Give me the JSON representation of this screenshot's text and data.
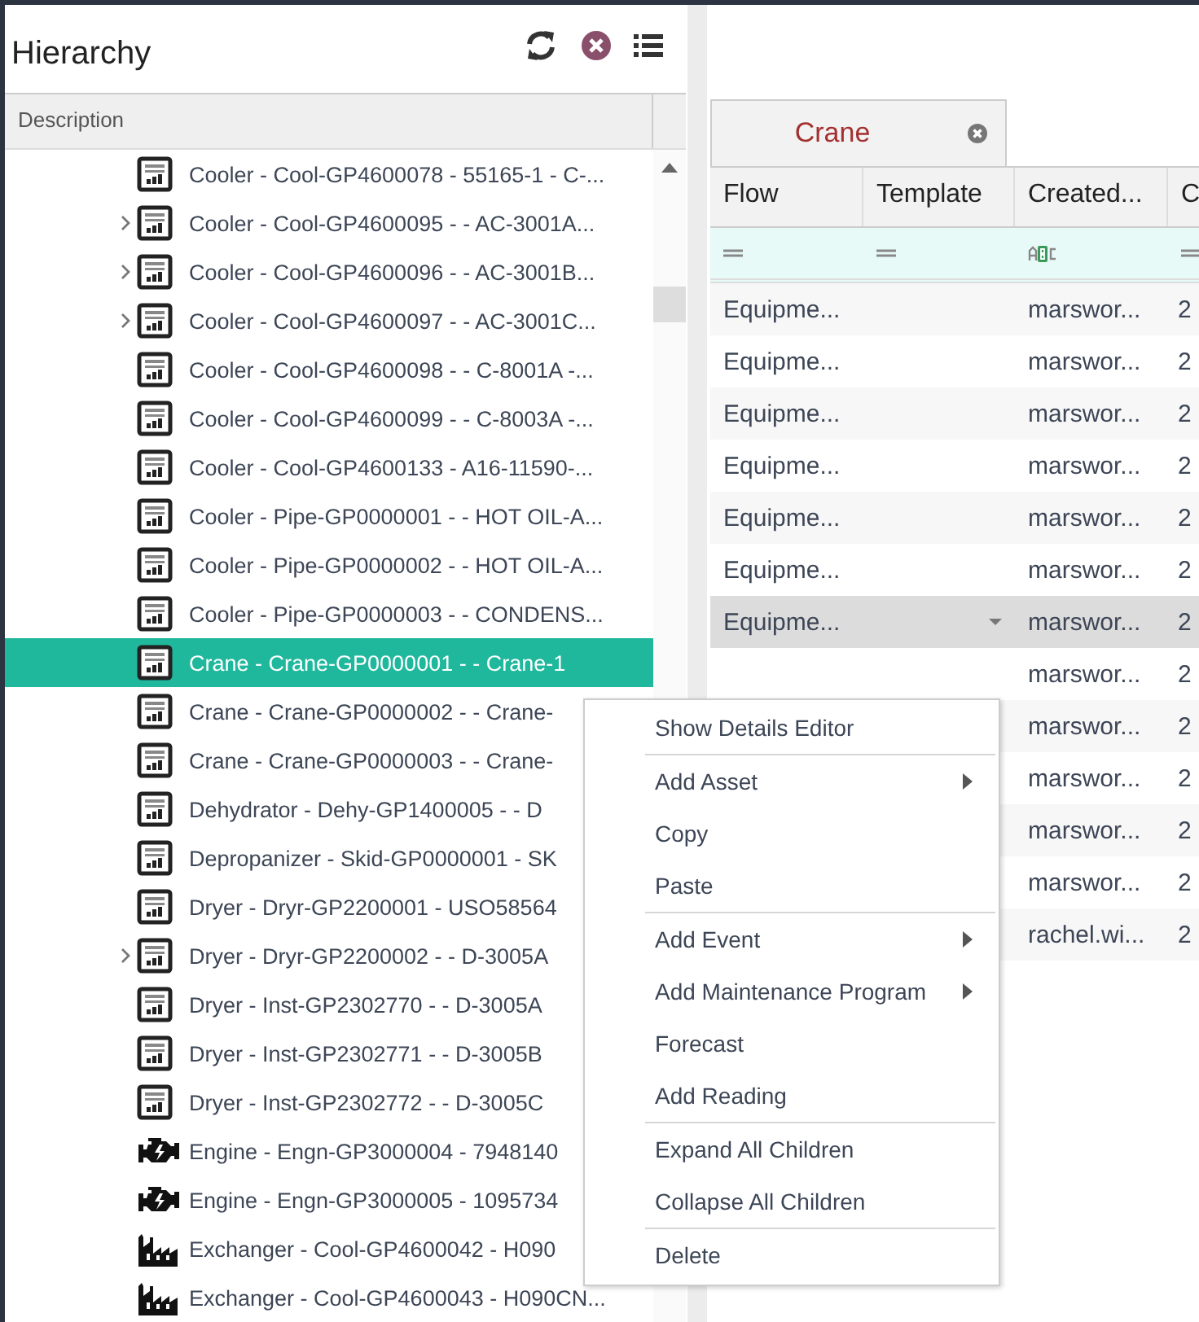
{
  "hierarchy": {
    "title": "Hierarchy",
    "column": "Description",
    "rows": [
      {
        "text": "Cooler - Cool-GP4600078 - 55165-1 - C-...",
        "kind": "gauge",
        "expandable": false,
        "selected": false
      },
      {
        "text": "Cooler - Cool-GP4600095 -  - AC-3001A...",
        "kind": "gauge",
        "expandable": true,
        "selected": false
      },
      {
        "text": "Cooler - Cool-GP4600096 -  - AC-3001B...",
        "kind": "gauge",
        "expandable": true,
        "selected": false
      },
      {
        "text": "Cooler - Cool-GP4600097 -  - AC-3001C...",
        "kind": "gauge",
        "expandable": true,
        "selected": false
      },
      {
        "text": "Cooler - Cool-GP4600098 -  - C-8001A -...",
        "kind": "gauge",
        "expandable": false,
        "selected": false
      },
      {
        "text": "Cooler - Cool-GP4600099 -  - C-8003A -...",
        "kind": "gauge",
        "expandable": false,
        "selected": false
      },
      {
        "text": "Cooler - Cool-GP4600133 - A16-11590-...",
        "kind": "gauge",
        "expandable": false,
        "selected": false
      },
      {
        "text": "Cooler - Pipe-GP0000001 -  - HOT OIL-A...",
        "kind": "gauge",
        "expandable": false,
        "selected": false
      },
      {
        "text": "Cooler - Pipe-GP0000002 -  - HOT OIL-A...",
        "kind": "gauge",
        "expandable": false,
        "selected": false
      },
      {
        "text": "Cooler - Pipe-GP0000003 -  - CONDENS...",
        "kind": "gauge",
        "expandable": false,
        "selected": false
      },
      {
        "text": "Crane - Crane-GP0000001 -  - Crane-1",
        "kind": "gauge",
        "expandable": false,
        "selected": true
      },
      {
        "text": "Crane - Crane-GP0000002 -  - Crane-",
        "kind": "gauge",
        "expandable": false,
        "selected": false
      },
      {
        "text": "Crane - Crane-GP0000003 -  - Crane-",
        "kind": "gauge",
        "expandable": false,
        "selected": false
      },
      {
        "text": "Dehydrator - Dehy-GP1400005 -  - D",
        "kind": "gauge",
        "expandable": false,
        "selected": false
      },
      {
        "text": "Depropanizer - Skid-GP0000001 - SK",
        "kind": "gauge",
        "expandable": false,
        "selected": false
      },
      {
        "text": "Dryer - Dryr-GP2200001 - USO58564",
        "kind": "gauge",
        "expandable": false,
        "selected": false
      },
      {
        "text": "Dryer - Dryr-GP2200002 -  - D-3005A",
        "kind": "gauge",
        "expandable": true,
        "selected": false
      },
      {
        "text": "Dryer - Inst-GP2302770 -  - D-3005A",
        "kind": "gauge",
        "expandable": false,
        "selected": false
      },
      {
        "text": "Dryer - Inst-GP2302771 -  - D-3005B",
        "kind": "gauge",
        "expandable": false,
        "selected": false
      },
      {
        "text": "Dryer - Inst-GP2302772 -  - D-3005C",
        "kind": "gauge",
        "expandable": false,
        "selected": false
      },
      {
        "text": "Engine - Engn-GP3000004 - 7948140",
        "kind": "engine",
        "expandable": false,
        "selected": false
      },
      {
        "text": "Engine - Engn-GP3000005 - 1095734",
        "kind": "engine",
        "expandable": false,
        "selected": false
      },
      {
        "text": "Exchanger - Cool-GP4600042 - H090",
        "kind": "factory",
        "expandable": false,
        "selected": false
      },
      {
        "text": "Exchanger - Cool-GP4600043 - H090CN...",
        "kind": "factory",
        "expandable": false,
        "selected": false
      }
    ]
  },
  "tabs": [
    {
      "label": "Crane",
      "selected": true
    }
  ],
  "table": {
    "columns": [
      {
        "label": "Flow",
        "kind": "equals"
      },
      {
        "label": "Template",
        "kind": "equals"
      },
      {
        "label": "Created...",
        "kind": "abc"
      },
      {
        "label": "C",
        "kind": "equals"
      }
    ],
    "rows": [
      {
        "flow": "Equipme...",
        "created": "marswor...",
        "column_4": "2",
        "selected": false
      },
      {
        "flow": "Equipme...",
        "created": "marswor...",
        "column_4": "2",
        "selected": false
      },
      {
        "flow": "Equipme...",
        "created": "marswor...",
        "column_4": "2",
        "selected": false
      },
      {
        "flow": "Equipme...",
        "created": "marswor...",
        "column_4": "2",
        "selected": false
      },
      {
        "flow": "Equipme...",
        "created": "marswor...",
        "column_4": "2",
        "selected": false
      },
      {
        "flow": "Equipme...",
        "created": "marswor...",
        "column_4": "2",
        "selected": false
      },
      {
        "flow": "Equipme...",
        "created": "marswor...",
        "column_4": "2",
        "selected": true
      },
      {
        "created": "marswor...",
        "column_4": "2",
        "selected": false
      },
      {
        "created": "marswor...",
        "column_4": "2",
        "selected": false
      },
      {
        "created": "marswor...",
        "column_4": "2",
        "selected": false
      },
      {
        "created": "marswor...",
        "column_4": "2",
        "selected": false
      },
      {
        "created": "marswor...",
        "column_4": "2",
        "selected": false
      },
      {
        "created": "rachel.wi...",
        "column_4": "2",
        "selected": false
      }
    ]
  },
  "context_menu": [
    {
      "label": "Show Details Editor",
      "submenu": false,
      "separator_before": false
    },
    {
      "label": "Add Asset",
      "submenu": true,
      "separator_before": true
    },
    {
      "label": "Copy",
      "submenu": false,
      "separator_before": false
    },
    {
      "label": "Paste",
      "submenu": false,
      "separator_before": false
    },
    {
      "label": "Add Event",
      "submenu": true,
      "separator_before": true
    },
    {
      "label": "Add Maintenance Program",
      "submenu": true,
      "separator_before": false
    },
    {
      "label": "Forecast",
      "submenu": false,
      "separator_before": false
    },
    {
      "label": "Add Reading",
      "submenu": false,
      "separator_before": false
    },
    {
      "label": "Expand All Children",
      "submenu": false,
      "separator_before": true
    },
    {
      "label": "Collapse All Children",
      "submenu": false,
      "separator_before": false
    },
    {
      "label": "Delete",
      "submenu": false,
      "separator_before": true
    }
  ]
}
